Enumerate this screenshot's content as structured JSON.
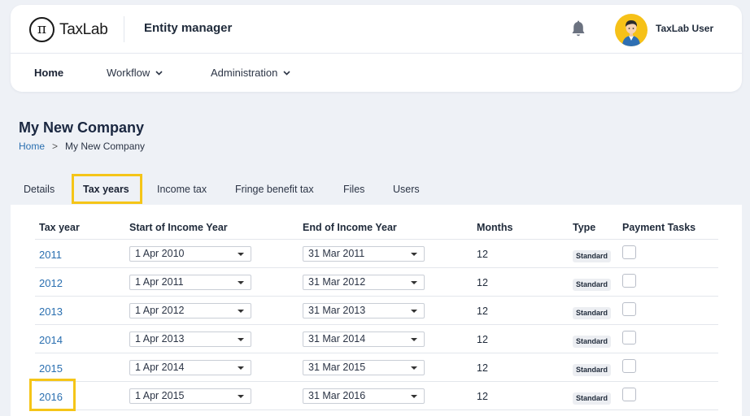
{
  "header": {
    "logo_symbol": "π",
    "logo_text": "TaxLab",
    "app_title": "Entity manager",
    "bell_icon": "bell-icon",
    "user_name": "TaxLab User",
    "avatar_color": "#f6c118"
  },
  "nav": {
    "home": "Home",
    "workflow": "Workflow",
    "administration": "Administration"
  },
  "page": {
    "company_title": "My New Company",
    "breadcrumb": {
      "home": "Home",
      "separator": ">",
      "current": "My New Company"
    }
  },
  "tabs": {
    "details": "Details",
    "tax_years": "Tax years",
    "income_tax": "Income tax",
    "fringe_benefit_tax": "Fringe benefit tax",
    "files": "Files",
    "users": "Users",
    "active": "Tax years",
    "highlight_color": "#f5c518"
  },
  "table": {
    "headers": {
      "tax_year": "Tax year",
      "start": "Start of Income Year",
      "end": "End of Income Year",
      "months": "Months",
      "type": "Type",
      "payment_tasks": "Payment Tasks"
    },
    "rows": [
      {
        "year": "2011",
        "start": "1 Apr 2010",
        "end": "31 Mar 2011",
        "months": "12",
        "type": "Standard",
        "payment_task": false
      },
      {
        "year": "2012",
        "start": "1 Apr 2011",
        "end": "31 Mar 2012",
        "months": "12",
        "type": "Standard",
        "payment_task": false
      },
      {
        "year": "2013",
        "start": "1 Apr 2012",
        "end": "31 Mar 2013",
        "months": "12",
        "type": "Standard",
        "payment_task": false
      },
      {
        "year": "2014",
        "start": "1 Apr 2013",
        "end": "31 Mar 2014",
        "months": "12",
        "type": "Standard",
        "payment_task": false
      },
      {
        "year": "2015",
        "start": "1 Apr 2014",
        "end": "31 Mar 2015",
        "months": "12",
        "type": "Standard",
        "payment_task": false
      },
      {
        "year": "2016",
        "start": "1 Apr 2015",
        "end": "31 Mar 2016",
        "months": "12",
        "type": "Standard",
        "payment_task": false
      }
    ],
    "highlighted_year": "2016"
  }
}
